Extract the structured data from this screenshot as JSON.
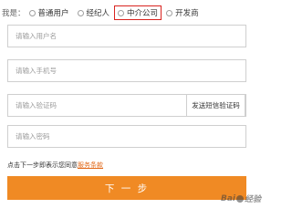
{
  "role": {
    "label": "我是：",
    "options": [
      {
        "label": "普通用户"
      },
      {
        "label": "经纪人"
      },
      {
        "label": "中介公司"
      },
      {
        "label": "开发商"
      }
    ]
  },
  "form": {
    "username_placeholder": "请输入用户名",
    "phone_placeholder": "请输入手机号",
    "code_placeholder": "请输入验证码",
    "send_code_label": "发送短信验证码",
    "password_placeholder": "请输入密码"
  },
  "agreement": {
    "text": "点击下一步即表示您同意",
    "link": "服务条款"
  },
  "next_label": "下 一 步",
  "watermark": {
    "left": "Bai",
    "right": "经验"
  },
  "colors": {
    "accent": "#f08a24",
    "highlight": "#d9231f",
    "link": "#e26a1b"
  }
}
